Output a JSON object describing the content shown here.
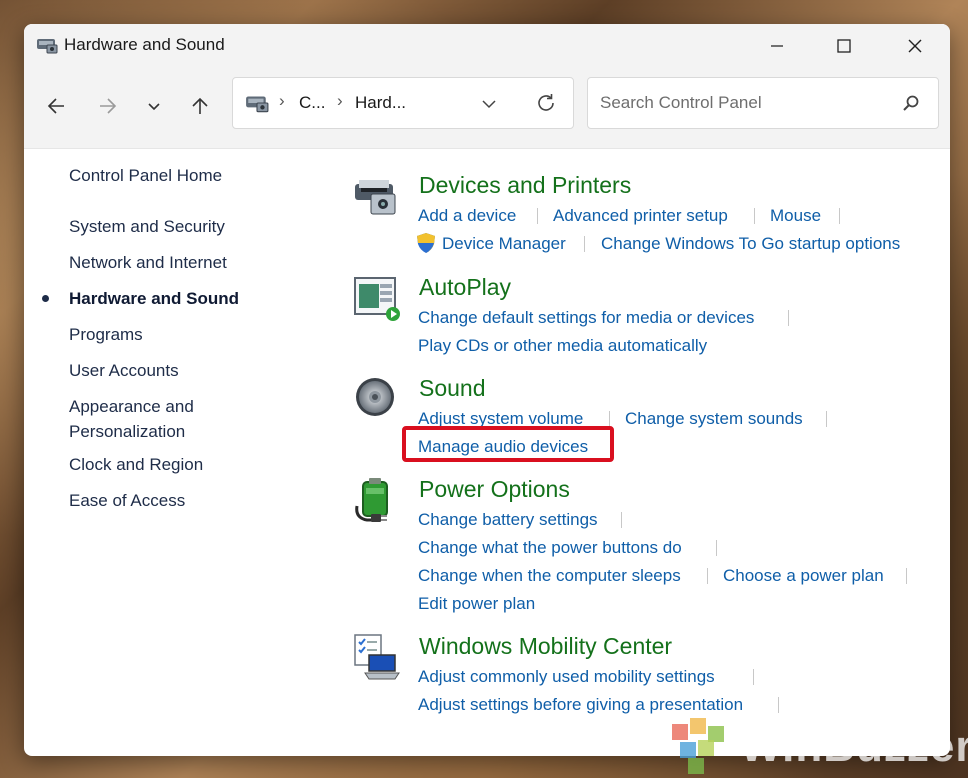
{
  "window": {
    "title": "Hardware and Sound"
  },
  "nav": {
    "breadcrumb": [
      "C...",
      "Hard..."
    ],
    "search_placeholder": "Search Control Panel"
  },
  "sidebar": {
    "home": "Control Panel Home",
    "items": [
      {
        "label": "System and Security"
      },
      {
        "label": "Network and Internet"
      },
      {
        "label": "Hardware and Sound",
        "active": true
      },
      {
        "label": "Programs"
      },
      {
        "label": "User Accounts"
      },
      {
        "label": "Appearance and"
      },
      {
        "label": "Personalization"
      },
      {
        "label": "Clock and Region"
      },
      {
        "label": "Ease of Access"
      }
    ]
  },
  "categories": {
    "devices": {
      "title": "Devices and Printers",
      "links": [
        "Add a device",
        "Advanced printer setup",
        "Mouse",
        "Device Manager",
        "Change Windows To Go startup options"
      ]
    },
    "autoplay": {
      "title": "AutoPlay",
      "links": [
        "Change default settings for media or devices",
        "Play CDs or other media automatically"
      ]
    },
    "sound": {
      "title": "Sound",
      "links": [
        "Adjust system volume",
        "Change system sounds",
        "Manage audio devices"
      ]
    },
    "power": {
      "title": "Power Options",
      "links": [
        "Change battery settings",
        "Change what the power buttons do",
        "Change when the computer sleeps",
        "Choose a power plan",
        "Edit power plan"
      ]
    },
    "mobility": {
      "title": "Windows Mobility Center",
      "links": [
        "Adjust commonly used mobility settings",
        "Adjust settings before giving a presentation"
      ]
    }
  },
  "watermark": {
    "text": "WinBuzzer"
  },
  "colors": {
    "link": "#0f5ea8",
    "category_title": "#14711b",
    "highlight": "#d90f1f"
  }
}
